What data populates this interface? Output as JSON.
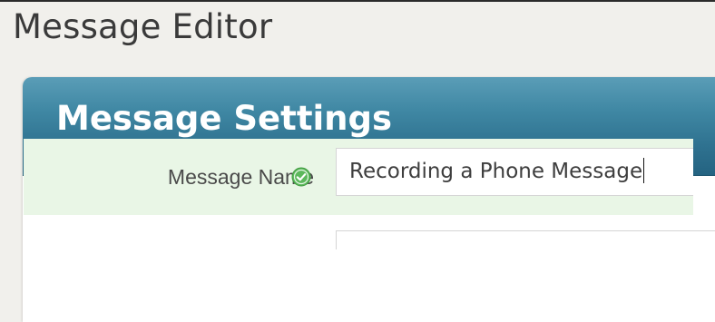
{
  "page": {
    "title": "Message Editor"
  },
  "panel": {
    "title": "Message Settings",
    "header_color": "#2f7290"
  },
  "fields": {
    "message_name": {
      "label": "Message Name",
      "value": "Recording a Phone Message",
      "status_icon": "check-circle-icon",
      "status": "valid",
      "row_color": "#e9f6e6"
    }
  }
}
